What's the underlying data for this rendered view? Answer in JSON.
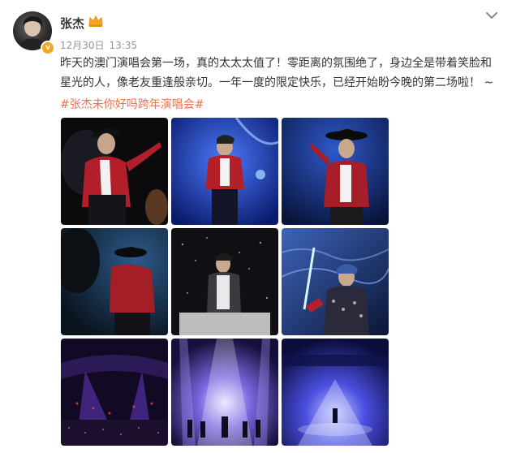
{
  "post": {
    "username": "张杰",
    "verified_badge": "v",
    "crown_icon": "crown-icon",
    "date": "12月30日",
    "time": "13:35",
    "text_line1": "昨天的澳门演唱会第一场，真的太太太值了！零距离的氛围绝了，身边全是带着笑脸和",
    "text_line2": "星光的人，像老友重逢般亲切。一年一度的限定快乐，已经开始盼今晚的第二场啦！ ~",
    "hashtag": "#张杰未你好吗跨年演唱会#",
    "colors": {
      "hashtag": "#eb7350",
      "meta": "#939393",
      "text": "#333333",
      "badge": "#f5a623"
    },
    "images": [
      {
        "name": "photo-singer-red-jacket-hat",
        "theme": "dark"
      },
      {
        "name": "photo-singer-red-jacket-blue-stage",
        "theme": "blue"
      },
      {
        "name": "photo-singer-black-hat-pose",
        "theme": "blue"
      },
      {
        "name": "photo-singer-back-view-hat",
        "theme": "dark"
      },
      {
        "name": "photo-singer-white-shirt-microphone",
        "theme": "dark"
      },
      {
        "name": "photo-singer-holding-light-rod",
        "theme": "blue"
      },
      {
        "name": "photo-arena-crowd-lights",
        "theme": "purple"
      },
      {
        "name": "photo-stage-spotlight-dancers",
        "theme": "purple"
      },
      {
        "name": "photo-stage-wide-blue",
        "theme": "blue"
      }
    ]
  }
}
